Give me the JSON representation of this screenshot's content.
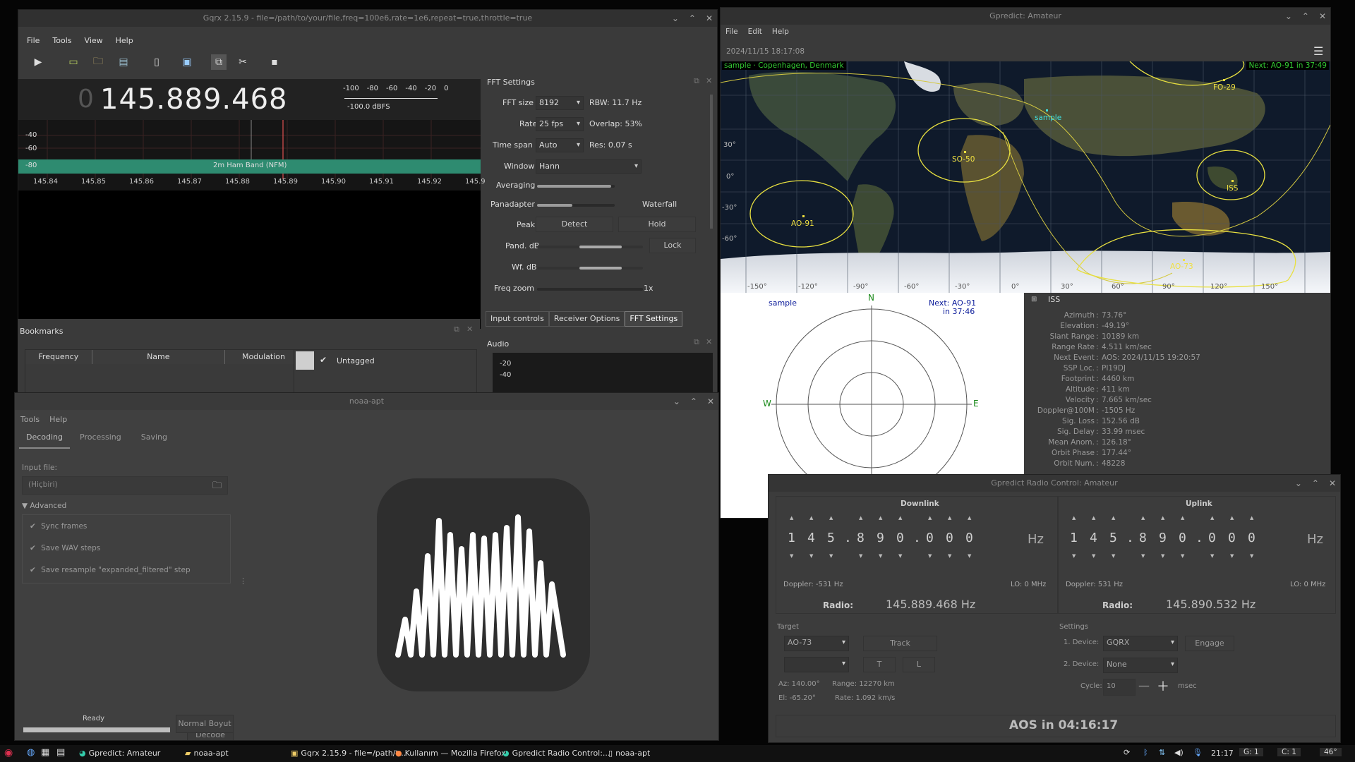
{
  "gqrx": {
    "title": "Gqrx 2.15.9 - file=/path/to/your/file,freq=100e6,rate=1e6,repeat=true,throttle=true",
    "menu": [
      "File",
      "Tools",
      "View",
      "Help"
    ],
    "freq_prefix": "0",
    "frequency": "145.889.468",
    "dbfs_scale": [
      "-100",
      "-80",
      "-60",
      "-40",
      "-20",
      "0"
    ],
    "dbfs_value": "-100.0 dBFS",
    "y_ticks": [
      "-40",
      "-60",
      "-80"
    ],
    "band_label": "2m Ham Band (NFM)",
    "x_ticks": [
      "145.84",
      "145.85",
      "145.86",
      "145.87",
      "145.88",
      "145.89",
      "145.90",
      "145.91",
      "145.92",
      "145.9"
    ],
    "fft": {
      "title": "FFT Settings",
      "fft_size_label": "FFT size",
      "fft_size": "8192",
      "rbw": "RBW: 11.7 Hz",
      "rate_label": "Rate",
      "rate": "25 fps",
      "overlap": "Overlap: 53%",
      "timespan_label": "Time span",
      "timespan": "Auto",
      "res": "Res: 0.07 s",
      "window_label": "Window",
      "window": "Hann",
      "averaging_label": "Averaging",
      "panadapter_label": "Panadapter",
      "waterfall_label": "Waterfall",
      "peak_label": "Peak",
      "detect": "Detect",
      "hold": "Hold",
      "pand_db_label": "Pand. dB",
      "lock": "Lock",
      "wf_db_label": "Wf. dB",
      "freq_zoom_label": "Freq zoom",
      "zoom": "1x"
    },
    "tabs": [
      "Input controls",
      "Receiver Options",
      "FFT Settings"
    ],
    "audio_title": "Audio",
    "audio_ticks": [
      "-20",
      "-40"
    ],
    "bookmarks": {
      "title": "Bookmarks",
      "headers": [
        "Frequency",
        "Name",
        "Modulation"
      ],
      "tag": "Untagged"
    }
  },
  "gpredict": {
    "title": "Gpredict: Amateur",
    "menu": [
      "File",
      "Edit",
      "Help"
    ],
    "timestamp": "2024/11/15 18:17:08",
    "map_location": "sample · Copenhagen, Denmark",
    "map_next": "Next: AO-91 in 37:49",
    "sats": [
      "FO-29",
      "sample",
      "SO-50",
      "ISS",
      "AO-91",
      "AO-73"
    ],
    "lat_labels": [
      "30°",
      "0°",
      "-30°",
      "-60°"
    ],
    "lon_labels": [
      "-150°",
      "-120°",
      "-90°",
      "-60°",
      "-30°",
      "0°",
      "30°",
      "60°",
      "90°",
      "120°",
      "150°"
    ],
    "polar_station": "sample",
    "polar_next_1": "Next: AO-91",
    "polar_next_2": "in 37:46",
    "compass": [
      "N",
      "W",
      "E"
    ],
    "iss_title": "ISS",
    "iss": [
      [
        "Azimuth",
        "73.76°"
      ],
      [
        "Elevation",
        "-49.19°"
      ],
      [
        "Slant Range",
        "10189 km"
      ],
      [
        "Range Rate",
        "4.511 km/sec"
      ],
      [
        "Next Event",
        "AOS: 2024/11/15 19:20:57"
      ],
      [
        "SSP Loc.",
        "PI19DJ"
      ],
      [
        "Footprint",
        "4460 km"
      ],
      [
        "Altitude",
        "411 km"
      ],
      [
        "Velocity",
        "7.665 km/sec"
      ],
      [
        "Doppler@100M",
        "-1505 Hz"
      ],
      [
        "Sig. Loss",
        "152.56 dB"
      ],
      [
        "Sig. Delay",
        "33.99 msec"
      ],
      [
        "Mean Anom.",
        "126.18°"
      ],
      [
        "Orbit Phase",
        "177.44°"
      ],
      [
        "Orbit Num.",
        "48228"
      ]
    ]
  },
  "noaa": {
    "title": "noaa-apt",
    "menu": [
      "Tools",
      "Help"
    ],
    "tabs": [
      "Decoding",
      "Processing",
      "Saving"
    ],
    "input_label": "Input file:",
    "input_placeholder": "(Hiçbiri)",
    "advanced": "Advanced",
    "checks": [
      "Sync frames",
      "Save WAV steps",
      "Save resample \"expanded_filtered\" step"
    ],
    "decode": "Decode",
    "status": "Ready",
    "normal_size": "Normal Boyut"
  },
  "radio": {
    "title": "Gpredict Radio Control: Amateur",
    "downlink": "Downlink",
    "uplink": "Uplink",
    "down_digits": [
      "1",
      "4",
      "5",
      ".",
      "8",
      "9",
      "0",
      ".",
      "0",
      "0",
      "0"
    ],
    "up_digits": [
      "1",
      "4",
      "5",
      ".",
      "8",
      "9",
      "0",
      ".",
      "0",
      "0",
      "0"
    ],
    "hz": "Hz",
    "down_doppler": "Doppler: -531 Hz",
    "up_doppler": "Doppler: 531 Hz",
    "lo": "LO:  0 MHz",
    "radio_label": "Radio:",
    "down_radio": "145.889.468 Hz",
    "up_radio": "145.890.532 Hz",
    "target_label": "Target",
    "target_sat": "AO-73",
    "track": "Track",
    "t": "T",
    "l": "L",
    "az": "Az:  140.00°",
    "range": "Range:  12270 km",
    "el": "El:  -65.20°",
    "rate": "Rate:  1.092 km/s",
    "settings_label": "Settings",
    "device1_label": "1. Device:",
    "device1": "GQRX",
    "engage": "Engage",
    "device2_label": "2. Device:",
    "device2": "None",
    "cycle_label": "Cycle:",
    "cycle": "10",
    "msec": "msec",
    "aos": "AOS in 04:16:17"
  },
  "taskbar": {
    "items": [
      "Gpredict: Amateur",
      "noaa-apt",
      "Gqrx 2.15.9 - file=/path/t...",
      "Kullanım — Mozilla Firefox",
      "Gpredict Radio Control:...",
      "noaa-apt"
    ],
    "time": "21:17",
    "g": "G:  1",
    "c": "C:  1",
    "temp": "46°"
  }
}
